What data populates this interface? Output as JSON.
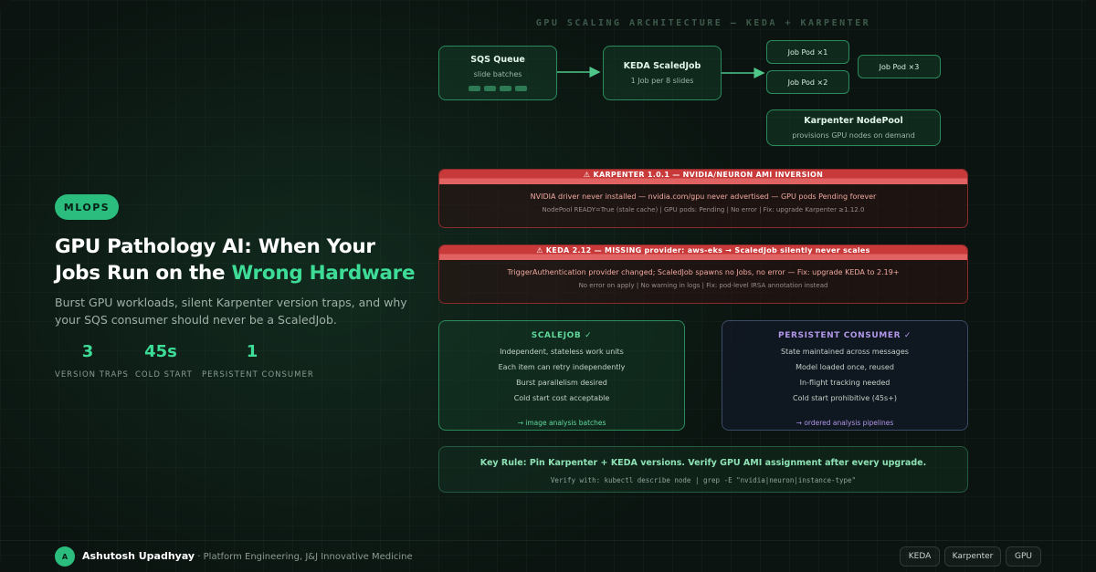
{
  "badge": "MLOPS",
  "title": {
    "part1": "GPU Pathology AI: When Your Jobs Run on the ",
    "highlight": "Wrong Hardware"
  },
  "subtitle": "Burst GPU workloads, silent Karpenter version traps, and why your SQS consumer should never be a ScaledJob.",
  "stats": [
    {
      "value": "3",
      "label": "VERSION TRAPS"
    },
    {
      "value": "45s",
      "label": "COLD START"
    },
    {
      "value": "1",
      "label": "PERSISTENT CONSUMER"
    }
  ],
  "diagram": {
    "title": "GPU SCALING ARCHITECTURE — KEDA + KARPENTER",
    "sqs": {
      "title": "SQS Queue",
      "sub": "slide batches"
    },
    "keda": {
      "title": "KEDA ScaledJob",
      "sub": "1 Job per 8 slides"
    },
    "pods": [
      "Job Pod ×1",
      "Job Pod ×2",
      "Job Pod ×3"
    ],
    "karpenter": {
      "title": "Karpenter NodePool",
      "sub": "provisions GPU nodes on demand"
    },
    "accent_color": "#2b8a5b"
  },
  "warnings": [
    {
      "head": "⚠ KARPENTER 1.0.1 — NVIDIA/NEURON AMI INVERSION",
      "main": "NVIDIA driver never installed — nvidia.com/gpu never advertised — GPU pods Pending forever",
      "detail": "NodePool READY=True (stale cache) | GPU pods: Pending | No error | Fix: upgrade Karpenter ≥1.12.0"
    },
    {
      "head": "⚠ KEDA 2.12 — MISSING provider: aws-eks → ScaledJob silently never scales",
      "main": "TriggerAuthentication provider changed; ScaledJob spawns no Jobs, no error — Fix: upgrade KEDA to 2.19+",
      "detail": "No error on apply | No warning in logs | Fix: pod-level IRSA annotation instead"
    }
  ],
  "comparison": {
    "scalejob": {
      "title": "SCALEJOB ✓",
      "items": [
        "Independent, stateless work units",
        "Each item can retry independently",
        "Burst parallelism desired",
        "Cold start cost acceptable"
      ],
      "foot": "→ image analysis batches",
      "color": "#5fd89a"
    },
    "persistent": {
      "title": "PERSISTENT CONSUMER ✓",
      "items": [
        "State maintained across messages",
        "Model loaded once, reused",
        "In-flight tracking needed",
        "Cold start prohibitive (45s+)"
      ],
      "foot": "→ ordered analysis pipelines",
      "color": "#b197e8"
    }
  },
  "key_rule": {
    "main": "Key Rule: Pin Karpenter + KEDA versions. Verify GPU AMI assignment after every upgrade.",
    "sub": "Verify with: kubectl describe node | grep -E \"nvidia|neuron|instance-type\""
  },
  "footer": {
    "avatar_initial": "A",
    "name": "Ashutosh Upadhyay",
    "role": " · Platform Engineering, J&J Innovative Medicine",
    "tags": [
      "KEDA",
      "Karpenter",
      "GPU"
    ]
  }
}
